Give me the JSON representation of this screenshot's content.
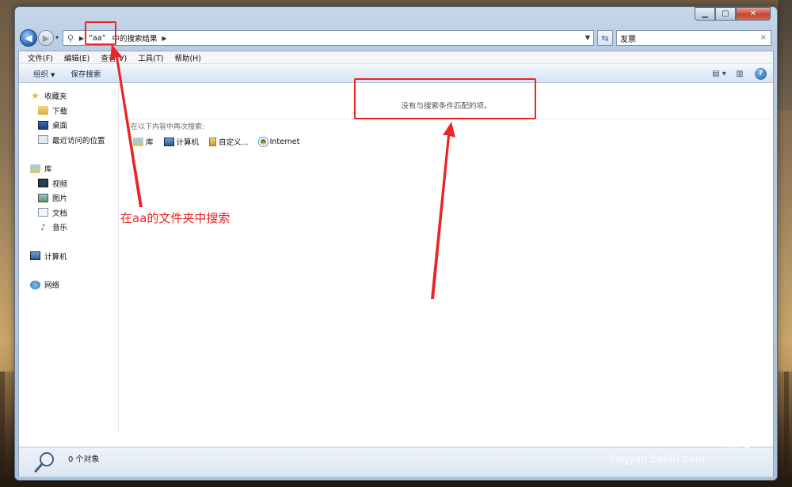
{
  "window": {
    "caption": {
      "min": "▁",
      "max": "▢",
      "close": "✕"
    }
  },
  "nav": {
    "back_glyph": "◀",
    "forward_glyph": "▶",
    "recent_glyph": "▾",
    "breadcrumb": [
      "“aa”",
      "中的搜索结果"
    ],
    "search_value": "发票",
    "search_clear": "×",
    "refresh_glyph": "⇆"
  },
  "menubar": {
    "items": [
      "文件(F)",
      "编辑(E)",
      "查看(V)",
      "工具(T)",
      "帮助(H)"
    ]
  },
  "toolbar": {
    "organize": "组织",
    "save_search": "保存搜索",
    "caret": "▼",
    "help": "?"
  },
  "navpane": {
    "favorites": {
      "label": "收藏夹",
      "items": [
        "下载",
        "桌面",
        "最近访问的位置"
      ]
    },
    "libraries": {
      "label": "库",
      "items": [
        "视频",
        "图片",
        "文档",
        "音乐"
      ]
    },
    "computer": {
      "label": "计算机"
    },
    "network": {
      "label": "网络"
    }
  },
  "main": {
    "no_results": "没有与搜索条件匹配的项。",
    "search_again_title": "在以下内容中再次搜索:",
    "search_again_items": [
      "库",
      "计算机",
      "自定义...",
      "Internet"
    ]
  },
  "status": {
    "count": "0 个对象"
  },
  "annotation": {
    "text": "在aa的文件夹中搜索",
    "color": "#ec2424"
  },
  "watermark": {
    "logo": "Bai du 经验",
    "sub": "jingyan.baidu.com"
  },
  "colors": {
    "accent": "#2d6fbf",
    "annotation": "#ec2424"
  }
}
